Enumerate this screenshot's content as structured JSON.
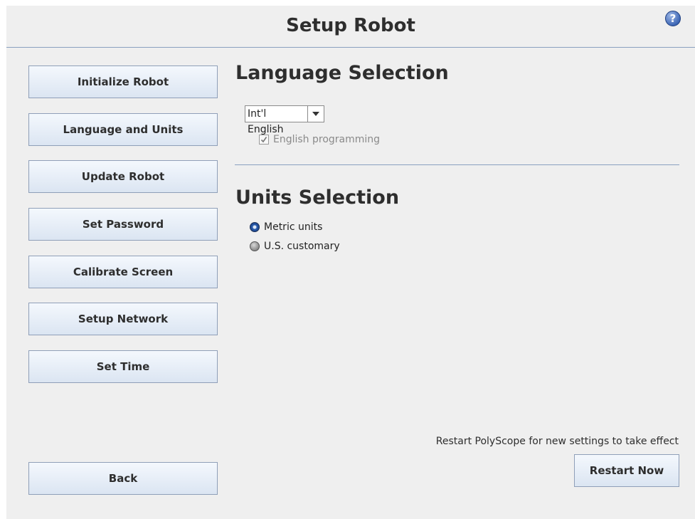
{
  "header": {
    "title": "Setup Robot",
    "help_icon_glyph": "?"
  },
  "sidebar": {
    "items": [
      {
        "label": "Initialize Robot"
      },
      {
        "label": "Language and Units"
      },
      {
        "label": "Update Robot"
      },
      {
        "label": "Set Password"
      },
      {
        "label": "Calibrate Screen"
      },
      {
        "label": "Setup Network"
      },
      {
        "label": "Set Time"
      }
    ],
    "back_label": "Back"
  },
  "language": {
    "title": "Language Selection",
    "selected": "Int'l English",
    "english_programming_label": "English programming",
    "english_programming_checked": true
  },
  "units": {
    "title": "Units Selection",
    "options": [
      {
        "label": "Metric units",
        "selected": true
      },
      {
        "label": "U.S. customary",
        "selected": false
      }
    ]
  },
  "footer": {
    "message": "Restart PolyScope for new settings to take effect",
    "restart_label": "Restart Now"
  },
  "colors": {
    "accent": "#2c5fb0",
    "divider": "#8aa0bf",
    "button_top": "#f4f8fd",
    "button_bottom": "#dbe5f2"
  }
}
